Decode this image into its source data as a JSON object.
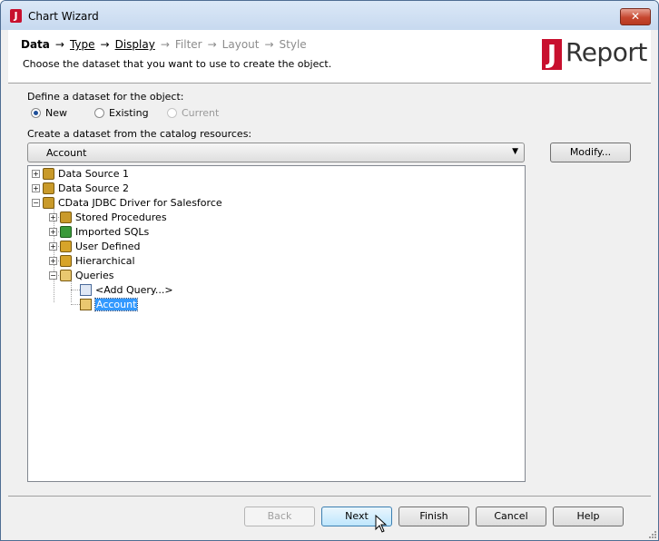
{
  "window": {
    "title": "Chart Wizard",
    "close_glyph": "✕"
  },
  "wizard": {
    "steps": [
      {
        "label": "Data",
        "state": "active"
      },
      {
        "label": "Type",
        "state": "link"
      },
      {
        "label": "Display",
        "state": "link"
      },
      {
        "label": "Filter",
        "state": "disabled"
      },
      {
        "label": "Layout",
        "state": "disabled"
      },
      {
        "label": "Style",
        "state": "disabled"
      }
    ],
    "arrow": "→",
    "subtitle": "Choose the dataset that you want to use to create the object."
  },
  "logo": {
    "mark": "J",
    "text": "Report",
    "color": "#c8102e"
  },
  "define": {
    "label": "Define a dataset for the object:",
    "options": [
      {
        "label": "New",
        "checked": true,
        "enabled": true
      },
      {
        "label": "Existing",
        "checked": false,
        "enabled": true
      },
      {
        "label": "Current",
        "checked": false,
        "enabled": false
      }
    ]
  },
  "catalog": {
    "label": "Create a dataset from the catalog resources:",
    "selected": "Account",
    "modify_label": "Modify..."
  },
  "tree": {
    "nodes": [
      {
        "label": "Data Source 1",
        "icon": "database-icon",
        "expander": "+"
      },
      {
        "label": "Data Source 2",
        "icon": "database-icon",
        "expander": "+"
      },
      {
        "label": "CData JDBC Driver for Salesforce",
        "icon": "database-icon",
        "expander": "−"
      },
      {
        "label": "Stored Procedures",
        "icon": "stored-procedure-icon",
        "expander": "+"
      },
      {
        "label": "Imported SQLs",
        "icon": "imported-sql-icon",
        "expander": "+"
      },
      {
        "label": "User Defined",
        "icon": "user-defined-icon",
        "expander": "+"
      },
      {
        "label": "Hierarchical",
        "icon": "hierarchical-icon",
        "expander": "+"
      },
      {
        "label": "Queries",
        "icon": "queries-folder-icon",
        "expander": "−"
      },
      {
        "label": "<Add Query...>",
        "icon": "add-query-icon",
        "expander": ""
      },
      {
        "label": "Account",
        "icon": "query-icon",
        "expander": "",
        "selected": true
      }
    ]
  },
  "buttons": {
    "back": "Back",
    "next": "Next",
    "finish": "Finish",
    "cancel": "Cancel",
    "help": "Help"
  },
  "colors": {
    "selection": "#3399ff",
    "disabled_text": "#8c8c8c",
    "brand": "#c8102e"
  }
}
